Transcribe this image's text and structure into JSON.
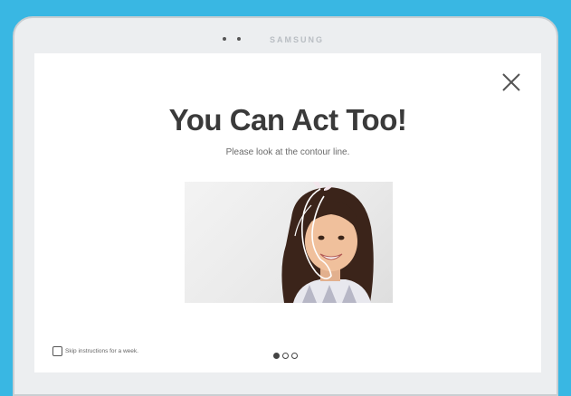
{
  "device": {
    "brand": "SAMSUNG"
  },
  "dialog": {
    "title": "You Can Act Too!",
    "subtitle": "Please look at the contour line.",
    "skip_label": "Skip instructions for a week.",
    "skip_checked": false,
    "pager": {
      "total": 3,
      "current": 1
    }
  },
  "icons": {
    "close": "close-icon"
  },
  "colors": {
    "background": "#39b7e3",
    "title": "#3a3a3a"
  }
}
